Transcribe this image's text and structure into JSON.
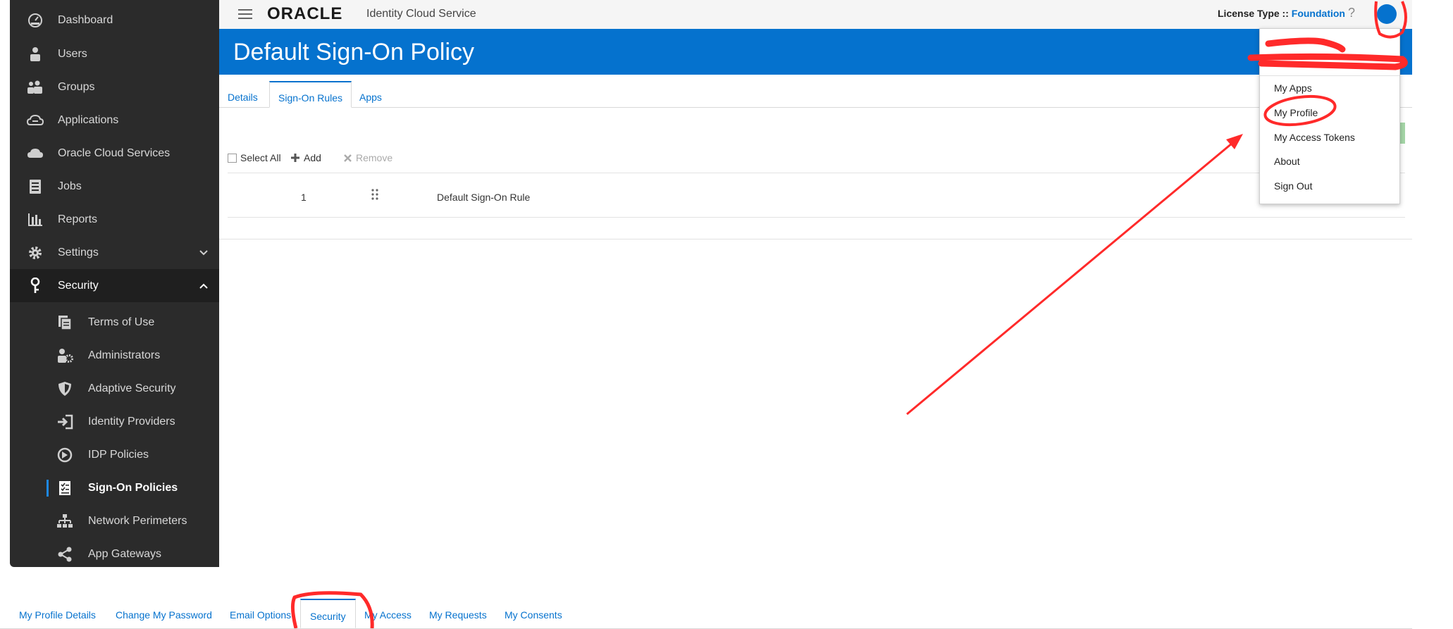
{
  "sidebar": {
    "items": [
      {
        "label": "Dashboard",
        "icon": "dashboard-icon"
      },
      {
        "label": "Users",
        "icon": "user-icon"
      },
      {
        "label": "Groups",
        "icon": "groups-icon"
      },
      {
        "label": "Applications",
        "icon": "cloud-outline-icon"
      },
      {
        "label": "Oracle Cloud Services",
        "icon": "cloud-icon"
      },
      {
        "label": "Jobs",
        "icon": "jobs-icon"
      },
      {
        "label": "Reports",
        "icon": "bar-chart-icon"
      },
      {
        "label": "Settings",
        "icon": "gear-icon"
      },
      {
        "label": "Security",
        "icon": "key-icon"
      }
    ],
    "security_sub_items": [
      {
        "label": "Terms of Use",
        "icon": "document-icon"
      },
      {
        "label": "Administrators",
        "icon": "admin-icon"
      },
      {
        "label": "Adaptive Security",
        "icon": "shield-icon"
      },
      {
        "label": "Identity Providers",
        "icon": "sign-in-icon"
      },
      {
        "label": "IDP Policies",
        "icon": "idp-policy-icon"
      },
      {
        "label": "Sign-On Policies",
        "icon": "checklist-icon"
      },
      {
        "label": "Network Perimeters",
        "icon": "network-icon"
      },
      {
        "label": "App Gateways",
        "icon": "share-icon"
      }
    ],
    "current_item": "Sign-On Policies"
  },
  "header": {
    "brand": "ORACLE",
    "product": "Identity Cloud Service",
    "license_label": "License Type ::",
    "license_value": "Foundation",
    "help": "?"
  },
  "page": {
    "title": "Default Sign-On Policy",
    "tabs": [
      {
        "label": "Details"
      },
      {
        "label": "Sign-On Rules",
        "active": true
      },
      {
        "label": "Apps"
      }
    ]
  },
  "toolbar": {
    "select_all": "Select All",
    "add": "Add",
    "remove": "Remove"
  },
  "rules": [
    {
      "order": "1",
      "name": "Default Sign-On Rule"
    }
  ],
  "user_menu": {
    "items": [
      "My Apps",
      "My Profile",
      "My Access Tokens",
      "About",
      "Sign Out"
    ]
  },
  "profile_tabs": [
    {
      "label": "My Profile Details"
    },
    {
      "label": "Change My Password"
    },
    {
      "label": "Email Options"
    },
    {
      "label": "Security",
      "active": true
    },
    {
      "label": "My Access"
    },
    {
      "label": "My Requests"
    },
    {
      "label": "My Consents"
    }
  ],
  "colors": {
    "brand_blue": "#0572ce",
    "sidebar_bg": "#2b2b2b",
    "annotation_red": "#ff2a2a"
  }
}
